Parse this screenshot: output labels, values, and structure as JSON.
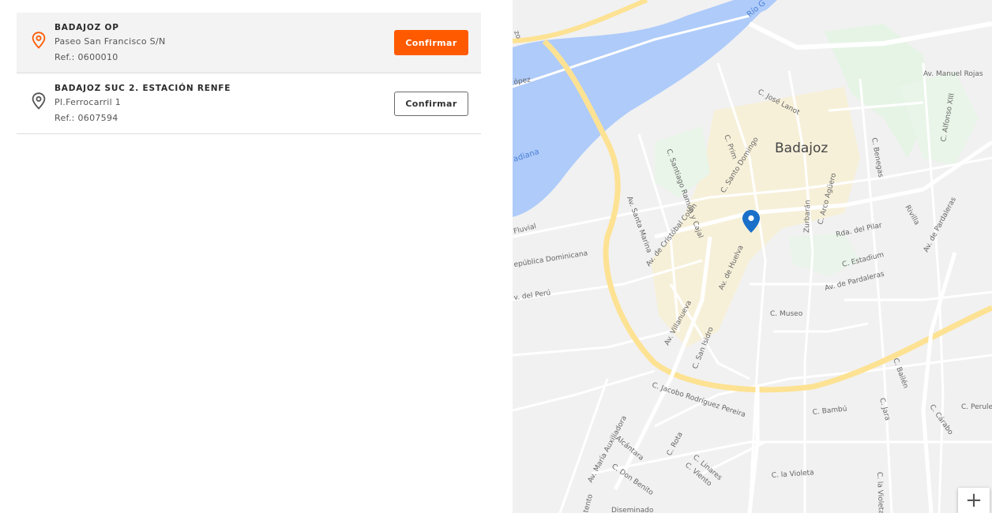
{
  "offices": [
    {
      "name": "BADAJOZ OP",
      "address": "Paseo San Francisco S/N",
      "ref": "Ref.: 0600010",
      "button_label": "Confirmar",
      "selected": true,
      "pin_color": "#ff5a00"
    },
    {
      "name": "BADAJOZ SUC 2. ESTACIÓN RENFE",
      "address": "Pl.Ferrocarril 1",
      "ref": "Ref.: 0607594",
      "button_label": "Confirmar",
      "selected": false,
      "pin_color": "#555555"
    }
  ],
  "map": {
    "city": "Badajoz",
    "labels": {
      "rio": "Río G",
      "guadiana": "adiana",
      "fluvial": "Fluvial",
      "republica": "epública Dominicana",
      "peru": "v. del Perú",
      "lopez": "ópez",
      "z0": "zo",
      "manuel_rojas": "Av. Manuel Rojas",
      "jose_lanot": "C. José Lanot",
      "prim": "C. Prim",
      "santo_domingo": "C. Santo Domingo",
      "benegas": "C. Benegas",
      "alfonso": "C. Alfonso XIII",
      "arco_aguero": "C. Arco Agüero",
      "zurbaran": "Zurbarán",
      "pilar": "Rda. del Pilar",
      "estadium": "C. Estadium",
      "pardaleras": "Av. de Pardaleras",
      "av_pardaleras_v": "Av. de Pardaleras",
      "santiago": "C. Santiago Ramón y Cajal",
      "santa_marina": "Av. Santa Marina",
      "colon": "Av. de Cristóbal Colón",
      "huelva": "Av. de Huelva",
      "museo": "C. Museo",
      "villanueva": "Av. Villanueva",
      "isidro": "C. San Isidro",
      "maria_aux": "Av. María Auxiliadora",
      "jacobo": "C. Jacobo Rodríguez Pereira",
      "rota": "C. Rota",
      "linares": "C. Linares",
      "viento": "C. Viento",
      "alcantara": "Alcántara",
      "don_benito": "C. Don Benito",
      "violeta": "C. la Violeta",
      "violeta_v": "C. la Violeta",
      "bambu": "C. Bambú",
      "jara": "C. Jara",
      "bailen": "C. Bailén",
      "carabo": "C. Cárabo",
      "perulero": "C. Perulero",
      "rivilla": "Rivilla",
      "diseminado": "Diseminado",
      "tento": "tento"
    },
    "marker_color": "#1a6fc9",
    "zoom_in_label": "+"
  }
}
